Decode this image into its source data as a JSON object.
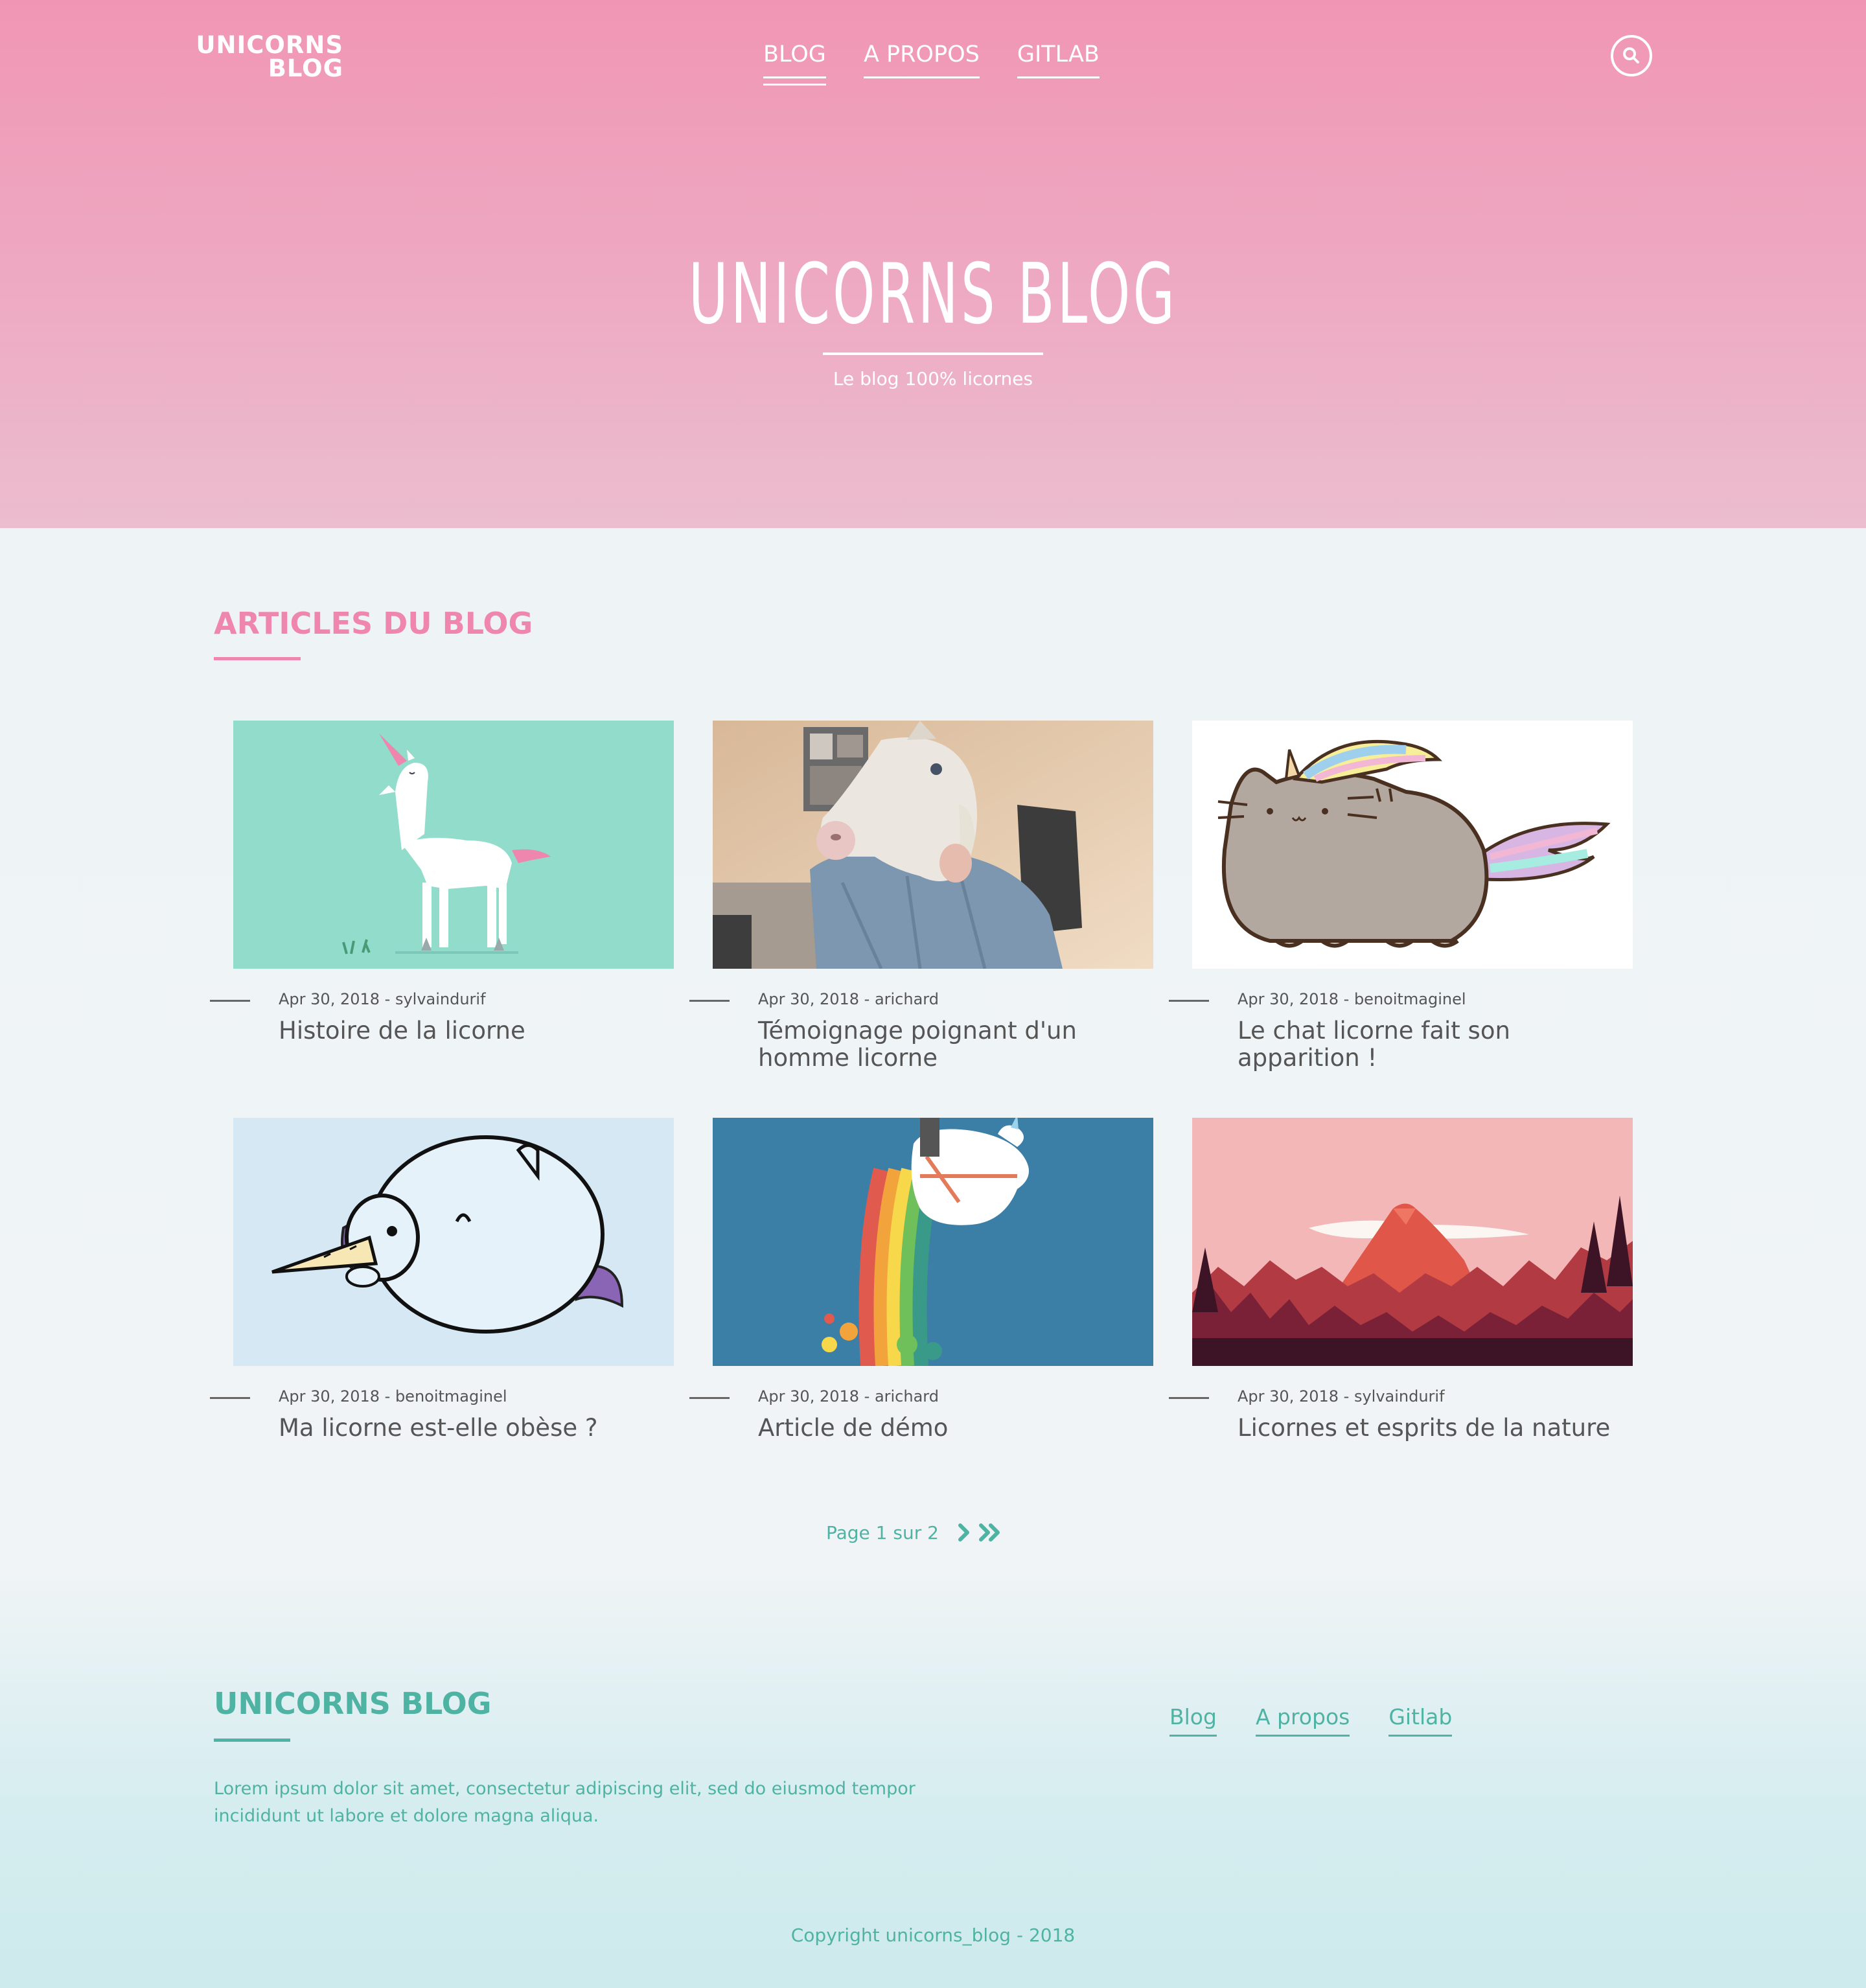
{
  "header": {
    "logo_line1": "UNICORNS",
    "logo_line2": "BLOG",
    "nav": [
      {
        "label": "BLOG",
        "active": true
      },
      {
        "label": "A PROPOS",
        "active": false
      },
      {
        "label": "GITLAB",
        "active": false
      }
    ],
    "search_icon": "search-icon"
  },
  "hero": {
    "title": "UNICORNS BLOG",
    "subtitle": "Le blog 100% licornes"
  },
  "articles": {
    "section_title": "ARTICLES DU BLOG",
    "items": [
      {
        "date": "Apr 30, 2018",
        "author": "sylvaindurif",
        "meta": "Apr 30, 2018 - sylvaindurif",
        "title": "Histoire de la licorne"
      },
      {
        "date": "Apr 30, 2018",
        "author": "arichard",
        "meta": "Apr 30, 2018 - arichard",
        "title": "Témoignage poignant d'un homme licorne"
      },
      {
        "date": "Apr 30, 2018",
        "author": "benoitmaginel",
        "meta": "Apr 30, 2018 - benoitmaginel",
        "title": "Le chat licorne fait son apparition !"
      },
      {
        "date": "Apr 30, 2018",
        "author": "benoitmaginel",
        "meta": "Apr 30, 2018 - benoitmaginel",
        "title": "Ma licorne est-elle obèse ?"
      },
      {
        "date": "Apr 30, 2018",
        "author": "arichard",
        "meta": "Apr 30, 2018 - arichard",
        "title": "Article de démo"
      },
      {
        "date": "Apr 30, 2018",
        "author": "sylvaindurif",
        "meta": "Apr 30, 2018 - sylvaindurif",
        "title": "Licornes et esprits de la nature"
      }
    ]
  },
  "pagination": {
    "label": "Page 1 sur 2",
    "current": 1,
    "total": 2
  },
  "footer": {
    "title": "UNICORNS BLOG",
    "text": "Lorem ipsum dolor sit amet, consectetur adipiscing elit, sed do eiusmod tempor incididunt ut labore et dolore magna aliqua.",
    "links": [
      "Blog",
      "A propos",
      "Gitlab"
    ],
    "copyright": "Copyright unicorns_blog - 2018"
  },
  "colors": {
    "pink": "#ef86ad",
    "teal": "#4fb3a3",
    "hero_top": "#f096b4",
    "hero_bottom": "#ebbdce"
  }
}
